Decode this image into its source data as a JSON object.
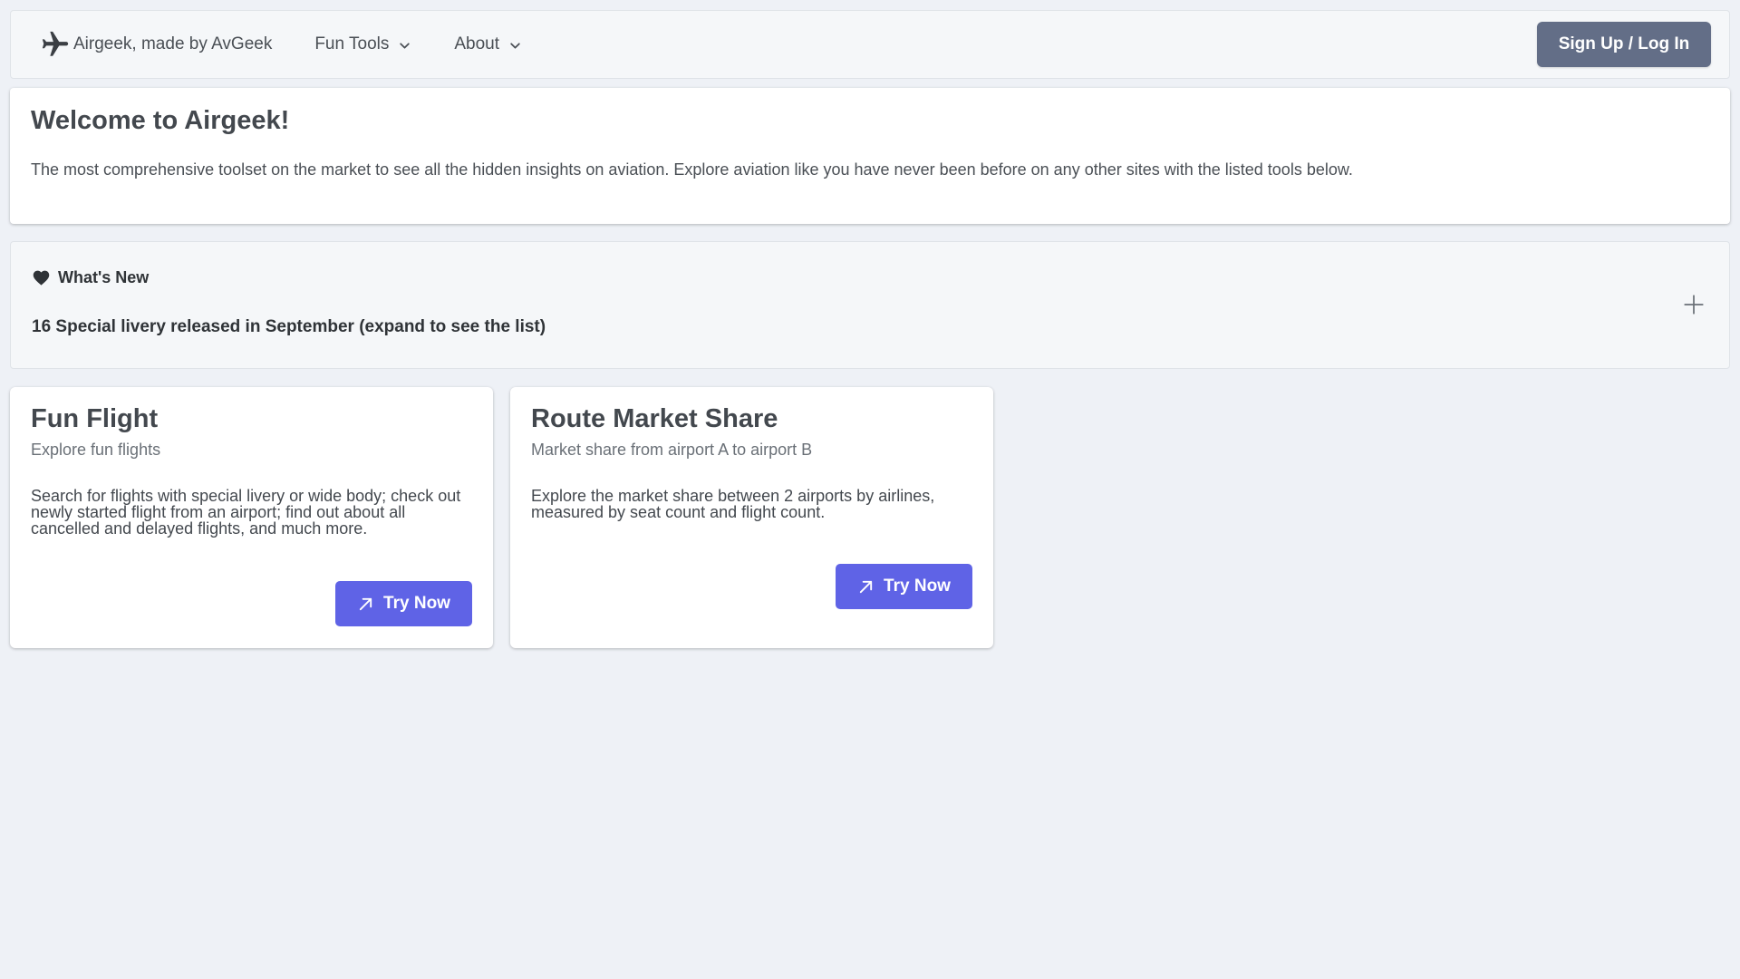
{
  "nav": {
    "brand_label": "Airgeek, made by AvGeek",
    "brand_icon": "airplane-icon",
    "menus": [
      {
        "label": "Fun Tools",
        "icon": "chevron-down-icon"
      },
      {
        "label": "About",
        "icon": "chevron-down-icon"
      }
    ],
    "signup_label": "Sign Up / Log In"
  },
  "welcome": {
    "title": "Welcome to Airgeek!",
    "text": "The most comprehensive toolset on the market to see all the hidden insights on aviation. Explore aviation like you have never been before on any other sites with the listed tools below."
  },
  "news": {
    "icon": "heart-icon",
    "title": "What's New",
    "summary": "16 Special livery released in September (expand to see the list)",
    "expand_icon": "plus-icon"
  },
  "cards": [
    {
      "title": "Fun Flight",
      "subtitle": "Explore fun flights",
      "description": "Search for flights with special livery or wide body; check out newly started flight from an airport; find out about all cancelled and delayed flights, and much more.",
      "button_label": "Try Now",
      "button_icon": "arrow-up-right-icon"
    },
    {
      "title": "Route Market Share",
      "subtitle": "Market share from airport A to airport B",
      "description": "Explore the market share between 2 airports by airlines, measured by seat count and flight count.",
      "button_label": "Try Now",
      "button_icon": "arrow-up-right-icon"
    }
  ],
  "colors": {
    "page_bg": "#eef1f6",
    "signup_button": "#636e87",
    "accent_button": "#5f63e6"
  }
}
